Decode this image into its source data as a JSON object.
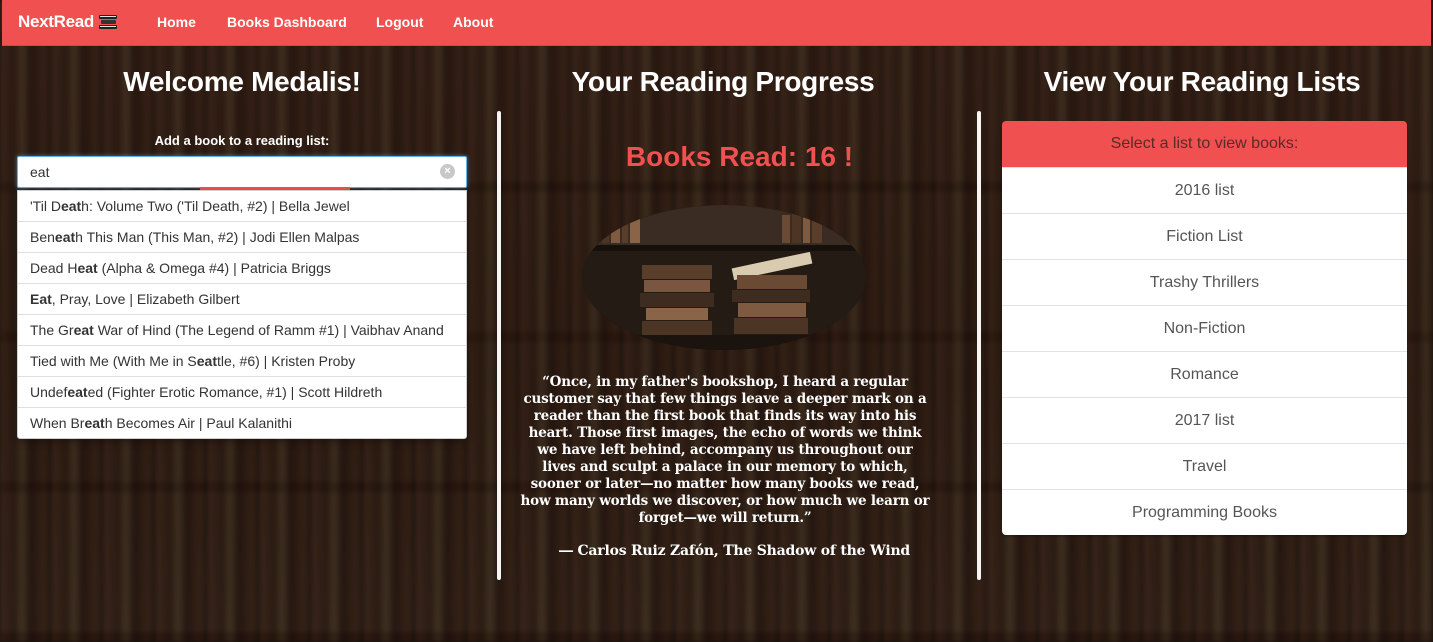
{
  "navbar": {
    "brand": "NextRead",
    "links": [
      "Home",
      "Books Dashboard",
      "Logout",
      "About"
    ]
  },
  "left": {
    "title": "Welcome Medalis!",
    "add_label": "Add a book to a reading list:",
    "search_value": "eat",
    "suggestions": [
      "'Til Death: Volume Two ('Til Death, #2) | Bella Jewel",
      "Beneath This Man (This Man, #2) | Jodi Ellen Malpas",
      "Dead Heat (Alpha & Omega #4) | Patricia Briggs",
      "Eat, Pray, Love | Elizabeth Gilbert",
      "The Great War of Hind (The Legend of Ramm #1) | Vaibhav Anand",
      "Tied with Me (With Me in Seattle, #6) | Kristen Proby",
      "Undefeated (Fighter Erotic Romance, #1) | Scott Hildreth",
      "When Breath Becomes Air | Paul Kalanithi"
    ]
  },
  "middle": {
    "title": "Your Reading Progress",
    "books_read": "Books Read: 16 !",
    "quote": "“Once, in my father's bookshop, I heard a regular customer say that few things leave a deeper mark on a reader than the first book that finds its way into his heart. Those first images, the echo of words we think we have left behind, accompany us throughout our lives and sculpt a palace in our memory to which, sooner or later—no matter how many books we read, how many worlds we discover, or how much we learn or forget—we will return.”",
    "author": "― Carlos Ruiz Zafón, The Shadow of the Wind"
  },
  "right": {
    "title": "View Your Reading Lists",
    "header": "Select a list to view books:",
    "lists": [
      "2016 list",
      "Fiction List",
      "Trashy Thrillers",
      "Non-Fiction",
      "Romance",
      "2017 list",
      "Travel",
      "Programming Books"
    ]
  },
  "colors": {
    "accent": "#f05050",
    "text_light": "#ffffff"
  },
  "icons": {
    "brand": "books-icon",
    "clear": "clear-circle-icon"
  }
}
